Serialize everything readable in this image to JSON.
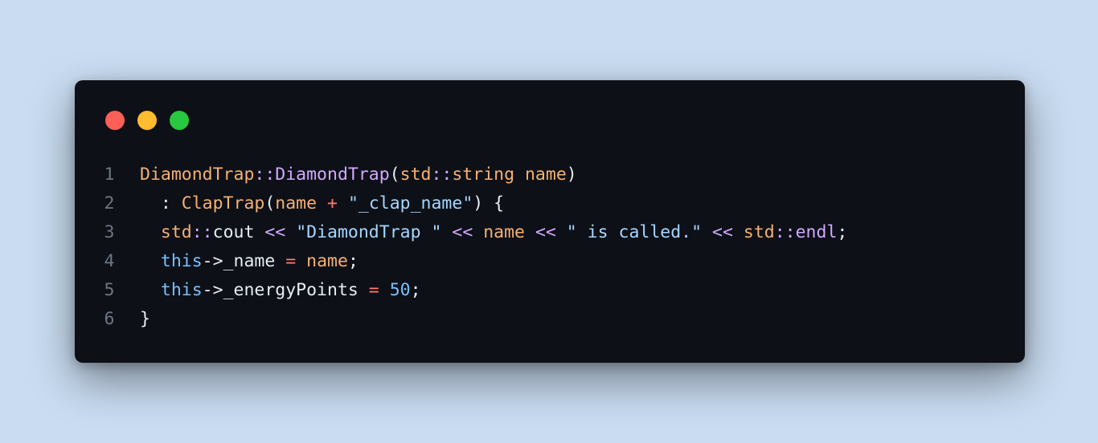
{
  "colors": {
    "background": "#c9dcf1",
    "window": "#0d1017",
    "line_number": "#6e7681",
    "window_controls": {
      "close": "#fe5f57",
      "minimize": "#febc2e",
      "maximize": "#28c840"
    }
  },
  "window_controls": [
    {
      "name": "close-dot",
      "color": "#fe5f57"
    },
    {
      "name": "minimize-dot",
      "color": "#febc2e"
    },
    {
      "name": "maximize-dot",
      "color": "#28c840"
    }
  ],
  "code": {
    "language": "cpp",
    "lines": [
      {
        "number": "1",
        "tokens": [
          {
            "text": "DiamondTrap",
            "color": "#f6b173"
          },
          {
            "text": "::",
            "color": "#d2a8ff"
          },
          {
            "text": "DiamondTrap",
            "color": "#d2a8ff"
          },
          {
            "text": "(",
            "color": "#e6edf3"
          },
          {
            "text": "std",
            "color": "#f6b173"
          },
          {
            "text": "::",
            "color": "#d2a8ff"
          },
          {
            "text": "string",
            "color": "#f6b173"
          },
          {
            "text": " ",
            "color": "#e6edf3"
          },
          {
            "text": "name",
            "color": "#f6b173"
          },
          {
            "text": ")",
            "color": "#e6edf3"
          }
        ]
      },
      {
        "number": "2",
        "tokens": [
          {
            "text": "  : ",
            "color": "#e6edf3"
          },
          {
            "text": "ClapTrap",
            "color": "#f6b173"
          },
          {
            "text": "(",
            "color": "#e6edf3"
          },
          {
            "text": "name",
            "color": "#f6b173"
          },
          {
            "text": " ",
            "color": "#e6edf3"
          },
          {
            "text": "+",
            "color": "#ff7b72"
          },
          {
            "text": " ",
            "color": "#e6edf3"
          },
          {
            "text": "\"_clap_name\"",
            "color": "#a5d6ff"
          },
          {
            "text": ") {",
            "color": "#e6edf3"
          }
        ]
      },
      {
        "number": "3",
        "tokens": [
          {
            "text": "  ",
            "color": "#e6edf3"
          },
          {
            "text": "std",
            "color": "#f6b173"
          },
          {
            "text": "::",
            "color": "#d2a8ff"
          },
          {
            "text": "cout",
            "color": "#e6edf3"
          },
          {
            "text": " ",
            "color": "#e6edf3"
          },
          {
            "text": "<<",
            "color": "#d2a8ff"
          },
          {
            "text": " ",
            "color": "#e6edf3"
          },
          {
            "text": "\"DiamondTrap \"",
            "color": "#a5d6ff"
          },
          {
            "text": " ",
            "color": "#e6edf3"
          },
          {
            "text": "<<",
            "color": "#d2a8ff"
          },
          {
            "text": " ",
            "color": "#e6edf3"
          },
          {
            "text": "name",
            "color": "#f6b173"
          },
          {
            "text": " ",
            "color": "#e6edf3"
          },
          {
            "text": "<<",
            "color": "#d2a8ff"
          },
          {
            "text": " ",
            "color": "#e6edf3"
          },
          {
            "text": "\" is called.\"",
            "color": "#a5d6ff"
          },
          {
            "text": " ",
            "color": "#e6edf3"
          },
          {
            "text": "<<",
            "color": "#d2a8ff"
          },
          {
            "text": " ",
            "color": "#e6edf3"
          },
          {
            "text": "std",
            "color": "#f6b173"
          },
          {
            "text": "::",
            "color": "#d2a8ff"
          },
          {
            "text": "endl",
            "color": "#d2a8ff"
          },
          {
            "text": ";",
            "color": "#e6edf3"
          }
        ]
      },
      {
        "number": "4",
        "tokens": [
          {
            "text": "  ",
            "color": "#e6edf3"
          },
          {
            "text": "this",
            "color": "#79c0ff"
          },
          {
            "text": "->",
            "color": "#e6edf3"
          },
          {
            "text": "_name",
            "color": "#e6edf3"
          },
          {
            "text": " ",
            "color": "#e6edf3"
          },
          {
            "text": "=",
            "color": "#ff7b72"
          },
          {
            "text": " ",
            "color": "#e6edf3"
          },
          {
            "text": "name",
            "color": "#f6b173"
          },
          {
            "text": ";",
            "color": "#e6edf3"
          }
        ]
      },
      {
        "number": "5",
        "tokens": [
          {
            "text": "  ",
            "color": "#e6edf3"
          },
          {
            "text": "this",
            "color": "#79c0ff"
          },
          {
            "text": "->",
            "color": "#e6edf3"
          },
          {
            "text": "_energyPoints",
            "color": "#e6edf3"
          },
          {
            "text": " ",
            "color": "#e6edf3"
          },
          {
            "text": "=",
            "color": "#ff7b72"
          },
          {
            "text": " ",
            "color": "#e6edf3"
          },
          {
            "text": "50",
            "color": "#79c0ff"
          },
          {
            "text": ";",
            "color": "#e6edf3"
          }
        ]
      },
      {
        "number": "6",
        "tokens": [
          {
            "text": "}",
            "color": "#e6edf3"
          }
        ]
      }
    ]
  }
}
